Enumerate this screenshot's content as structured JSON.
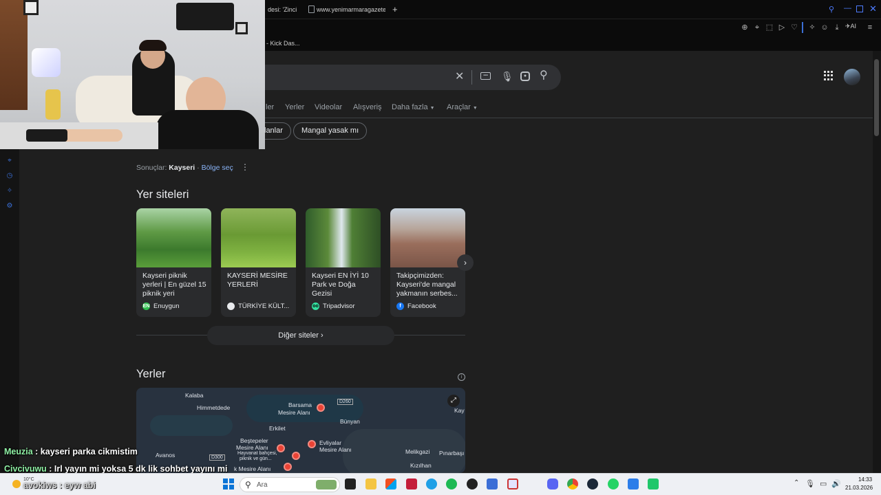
{
  "browser": {
    "tabs": [
      {
        "label": "desi: 'Zinci"
      },
      {
        "label": "www.yenimarmaragazetesi"
      }
    ],
    "new_tab": "+",
    "bookmark": "- Kick Das..."
  },
  "search": {
    "clear_icon": "close-icon",
    "keyboard_icon": "keyboard-icon",
    "mic_icon": "mic-icon",
    "lens_icon": "lens-icon",
    "search_icon": "search-icon"
  },
  "nav": {
    "partial": "ler",
    "tabs": [
      "Yerler",
      "Videolar",
      "Alışveriş",
      "Daha fazla",
      "Araçlar"
    ]
  },
  "chips": [
    "lanlar",
    "Mangal yasak mı"
  ],
  "results_line": {
    "prefix": "Sonuçlar:",
    "location": "Kayseri",
    "sep": "·",
    "link": "Bölge seç"
  },
  "sites": {
    "heading": "Yer siteleri",
    "cards": [
      {
        "title": "Kayseri piknik yerleri | En güzel 15 piknik yeri",
        "source": "Enuygun",
        "fav": "EN",
        "fav_color": "#2fbf4e"
      },
      {
        "title": "KAYSERİ MESİRE YERLERİ",
        "source": "TÜRKİYE KÜLT...",
        "fav": "",
        "fav_color": "#e8eaed"
      },
      {
        "title": "Kayseri EN İYİ 10 Park ve Doğa Gezisi",
        "source": "Tripadvisor",
        "fav": "oo",
        "fav_color": "#34e0a1"
      },
      {
        "title": "Takipçimizden: Kayseri'de mangal yakmanın serbes...",
        "source": "Facebook",
        "fav": "f",
        "fav_color": "#1877f2"
      }
    ],
    "more": "Diğer siteler"
  },
  "places": {
    "heading": "Yerler",
    "map_labels": [
      {
        "text": "Kalaba"
      },
      {
        "text": "Himmetdede"
      },
      {
        "text": "Barsama"
      },
      {
        "text": "Mesire Alanı"
      },
      {
        "text": "Bünyan"
      },
      {
        "text": "D260"
      },
      {
        "text": "Erkilet"
      },
      {
        "text": "Beştepeler"
      },
      {
        "text": "Mesire Alanı"
      },
      {
        "text": "Hayvanat bahçesi,"
      },
      {
        "text": "piknik ve gün..."
      },
      {
        "text": "Evliyalar"
      },
      {
        "text": "Mesire Alanı"
      },
      {
        "text": "Avanos"
      },
      {
        "text": "D300"
      },
      {
        "text": "k Mesire Alanı"
      },
      {
        "text": "Melikgazi"
      },
      {
        "text": "Pınarbaşı"
      },
      {
        "text": "Kızılhan"
      },
      {
        "text": "Kay"
      }
    ]
  },
  "chat": [
    {
      "user": "Meuzia",
      "message": " : kayseri parka cikmistim",
      "color": "#8ff0a4"
    },
    {
      "user": "Civcivuwu",
      "message": " : Irl yayın mi yoksa 5 dk lik sohbet yayını mi",
      "color": "#8ff0a4"
    },
    {
      "user": "avokiws",
      "message": " : eyw abi",
      "color": "#cfcfcf"
    }
  ],
  "taskbar": {
    "weather": "10°C",
    "search_placeholder": "Ara",
    "time": "14:33",
    "date": "21.03.2026"
  }
}
